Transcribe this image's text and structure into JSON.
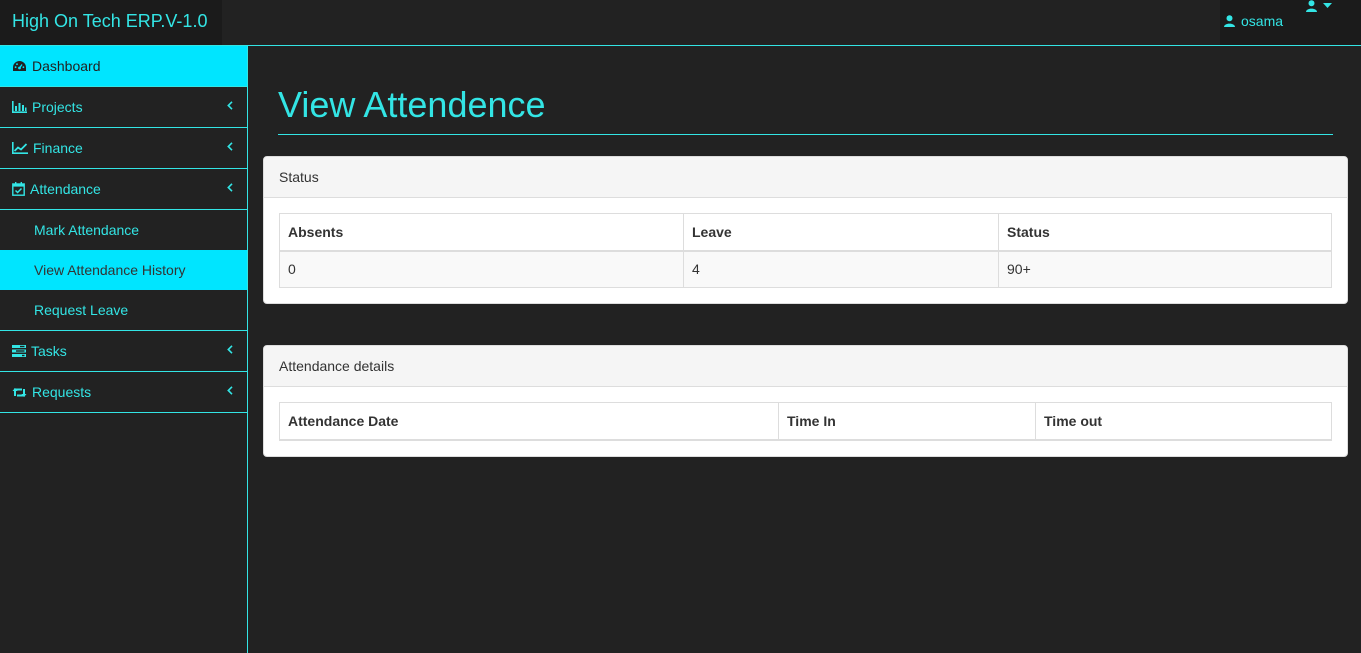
{
  "app": {
    "brand": "High On Tech ERP.V-1.0"
  },
  "topbar": {
    "username": "osama"
  },
  "sidebar": {
    "items": [
      {
        "label": "Dashboard",
        "icon": "dashboard-icon"
      },
      {
        "label": "Projects",
        "icon": "bar-chart-icon"
      },
      {
        "label": "Finance",
        "icon": "line-chart-icon"
      },
      {
        "label": "Attendance",
        "icon": "calendar-check-icon"
      },
      {
        "label": "Tasks",
        "icon": "tasks-icon"
      },
      {
        "label": "Requests",
        "icon": "retweet-icon"
      }
    ],
    "attendance_sub": [
      {
        "label": "Mark Attendance"
      },
      {
        "label": "View Attendance History"
      },
      {
        "label": "Request Leave"
      }
    ]
  },
  "main": {
    "title": "View Attendence",
    "status_panel": {
      "heading": "Status",
      "columns": [
        "Absents",
        "Leave",
        "Status"
      ],
      "rows": [
        [
          "0",
          "4",
          "90+"
        ]
      ]
    },
    "details_panel": {
      "heading": "Attendance details",
      "columns": [
        "Attendance Date",
        "Time In",
        "Time out"
      ],
      "rows": []
    }
  },
  "colors": {
    "accent": "#33e5e5",
    "active_bg": "#00e5ff",
    "background": "#222222"
  }
}
